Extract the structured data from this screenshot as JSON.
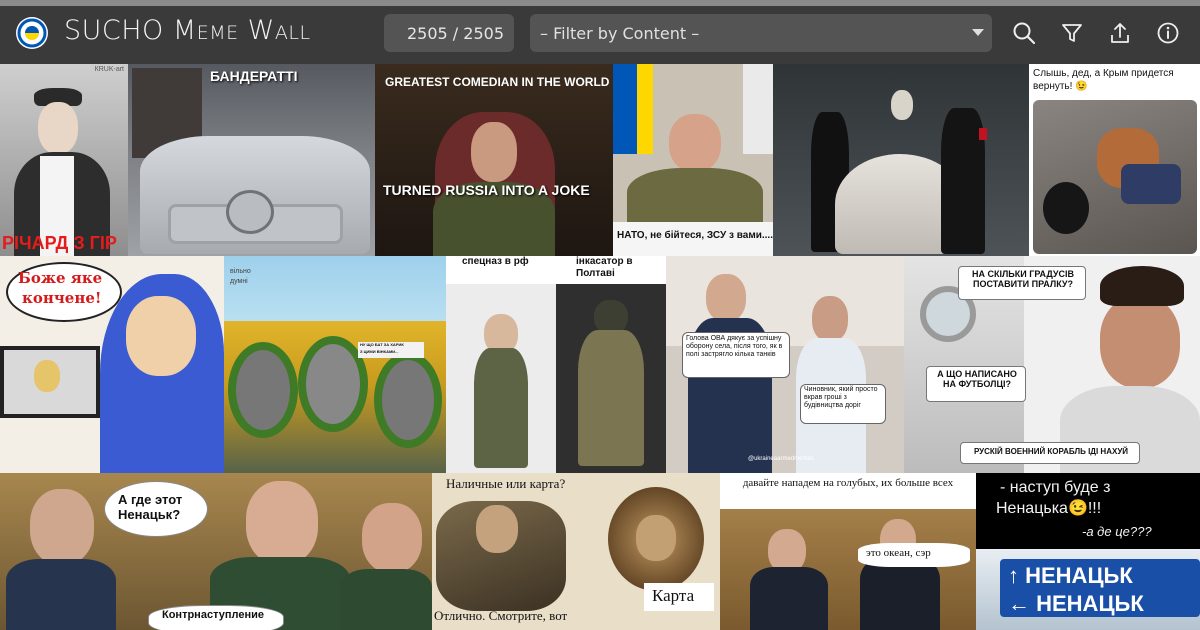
{
  "header": {
    "title_first": "SUCHO",
    "title_rest": "Meme Wall",
    "counter": "2505 / 2505",
    "filter_placeholder": "– Filter by Content –",
    "icons": [
      "search-icon",
      "filter-icon",
      "share-icon",
      "info-icon"
    ]
  },
  "colors": {
    "header_bg": "#3a3a3a",
    "control_bg": "#545454",
    "ukraine_blue": "#0057b7",
    "ukraine_yellow": "#ffd700"
  },
  "memes": {
    "m1": {
      "text": "РІЧАРД З ГІР",
      "watermark": "КRUK-art"
    },
    "m2": {
      "text": "БАНДЕРАТТІ"
    },
    "m3": {
      "top": "GREATEST COMEDIAN IN THE WORLD",
      "bottom": "TURNED RUSSIA INTO A JOKE"
    },
    "m4": {
      "text": "НАТО, не бійтеся, ЗСУ з вами...."
    },
    "m5": {},
    "m6": {
      "line1": "Слышь, дед, а Крым придется",
      "line2": "вернуть! 😉"
    },
    "m7": {
      "line1": "Боже яке",
      "line2": "кончене!"
    },
    "m8": {
      "watermark_line1": "вільно",
      "watermark_line2": "думні",
      "sign_line1": "НУ ЩО БАТ ЗА ХАРИК",
      "sign_line2": "З ЦИМИ ВІНКАМИ..."
    },
    "m9": {
      "left": "спецназ в рф",
      "right": "інкасатор в Полтаві"
    },
    "m10": {
      "bubble1": "Голова ОВА дякує за успішну оборону села, після того, як в полі застрягло кілька танків",
      "bubble2": "Чиновник, який просто вкрав гроші з будівництва доріг",
      "watermark": "@ukraineaarmedmemes"
    },
    "m11": {
      "q": "НА СКІЛЬКИ ГРАДУСІВ ПОСТАВИТИ ПРАЛКУ?",
      "a": "А ЩО НАПИСАНО НА ФУТБОЛЦІ?",
      "shirt": "РУСКІЙ ВОЕННИЙ КОРАБЛЬ ІДІ НАХУЙ"
    },
    "m12": {
      "bubble": "А где этот Ненацьк?",
      "bottom": "Контрнаступление"
    },
    "m13": {
      "top": "Наличные или карта?",
      "right": "Карта",
      "bottom": "Отлично. Смотрите, вот"
    },
    "m14": {
      "top": "давайте нападем на голубых, их больше всех",
      "bubble": "это океан, сэр"
    },
    "m15": {
      "line1": "- наступ буде з",
      "line2": "Ненацька😉!!!",
      "line3": "-а де це???",
      "sign1": "↑ НЕНАЦЬК",
      "sign2": "← НЕНАЦЬК"
    }
  }
}
